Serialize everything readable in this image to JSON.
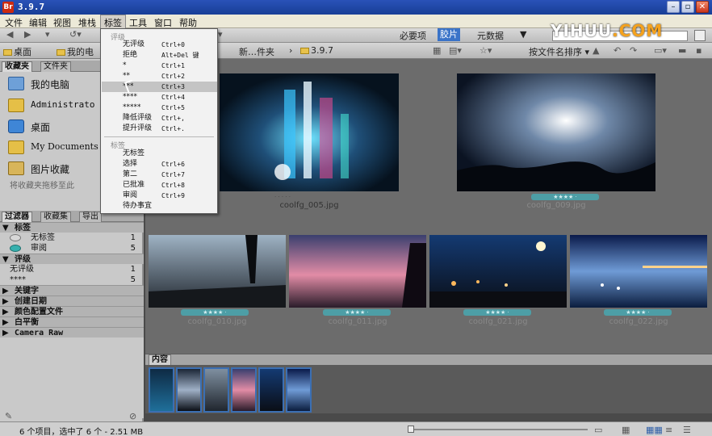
{
  "window": {
    "title": "3.9.7"
  },
  "logo": {
    "main": "YIHUU",
    "suffix": ".COM"
  },
  "menubar": [
    "文件",
    "编辑",
    "视图",
    "堆栈",
    "标签",
    "工具",
    "窗口",
    "帮助"
  ],
  "workspaces": [
    "必要项",
    "胶片",
    "元数据"
  ],
  "path": {
    "items": [
      "桌面",
      "我的电",
      "新…件夹",
      "3.9.7"
    ]
  },
  "sort_label": "按文件名排序",
  "dropdown": {
    "rating_header": "评级",
    "rating_items": [
      {
        "label": "无评级",
        "shortcut": "Ctrl+0"
      },
      {
        "label": "拒绝",
        "shortcut": "Alt+Del 键"
      },
      {
        "label": "*",
        "shortcut": "Ctrl+1"
      },
      {
        "label": "**",
        "shortcut": "Ctrl+2"
      },
      {
        "label": "***",
        "shortcut": "Ctrl+3"
      },
      {
        "label": "****",
        "shortcut": "Ctrl+4"
      },
      {
        "label": "*****",
        "shortcut": "Ctrl+5"
      },
      {
        "label": "降低评级",
        "shortcut": "Ctrl+,"
      },
      {
        "label": "提升评级",
        "shortcut": "Ctrl+."
      }
    ],
    "label_header": "标签",
    "label_items": [
      {
        "label": "无标签",
        "shortcut": ""
      },
      {
        "label": "选择",
        "shortcut": "Ctrl+6"
      },
      {
        "label": "第二",
        "shortcut": "Ctrl+7"
      },
      {
        "label": "已批准",
        "shortcut": "Ctrl+8"
      },
      {
        "label": "审阅",
        "shortcut": "Ctrl+9"
      },
      {
        "label": "待办事宜",
        "shortcut": ""
      }
    ]
  },
  "favorites_panel": {
    "tabs": [
      "收藏夹",
      "文件夹"
    ],
    "items": [
      {
        "label": "我的电脑",
        "icon": "computer-icon"
      },
      {
        "label": "Administrato",
        "icon": "folder-icon"
      },
      {
        "label": "桌面",
        "icon": "desktop-icon"
      },
      {
        "label": "My Documents",
        "icon": "folder-icon"
      },
      {
        "label": "图片收藏",
        "icon": "pictures-icon"
      }
    ],
    "hint": "将收藏夹拖移至此"
  },
  "filter_panel": {
    "tabs": [
      "过滤器",
      "收藏集",
      "导出"
    ],
    "label_section": "标签",
    "label_rows": [
      {
        "label": "无标签",
        "count": "1",
        "color": "#d7d7d7"
      },
      {
        "label": "审阅",
        "count": "5",
        "color": "#37b0ae"
      }
    ],
    "rating_section": "评级",
    "rating_rows": [
      {
        "label": "无评级",
        "count": "1"
      },
      {
        "label": "****",
        "count": "5"
      }
    ],
    "collapsed_sections": [
      "关键字",
      "创建日期",
      "颜色配置文件",
      "白平衡",
      "Camera Raw"
    ]
  },
  "thumbnails": [
    {
      "file": "coolfg_005.jpg",
      "stars": "· · · · ·"
    },
    {
      "file": "coolfg_009.jpg",
      "stars": "★★★★ ·"
    },
    {
      "file": "coolfg_010.jpg",
      "stars": "★★★★ ·"
    },
    {
      "file": "coolfg_011.jpg",
      "stars": "★★★★ ·"
    },
    {
      "file": "coolfg_021.jpg",
      "stars": "★★★★ ·"
    },
    {
      "file": "coolfg_022.jpg",
      "stars": "★★★★ ·"
    }
  ],
  "content_panel": {
    "title": "内容"
  },
  "status": {
    "text": "6 个项目，选中了 6 个 - 2.51 MB"
  },
  "colors": {
    "accent": "#3a73c8",
    "star_badge": "#4d9ea6",
    "title_bar": "#1f4aa8"
  }
}
